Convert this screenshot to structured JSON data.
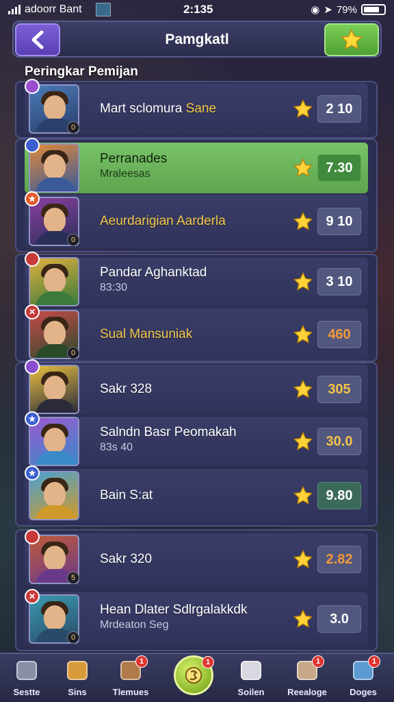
{
  "status_bar": {
    "carrier": "adoorr Bant",
    "time": "2:135",
    "battery": "79%"
  },
  "header": {
    "title": "Pamgkatl",
    "back_icon": "chevron-left-icon",
    "action_icon": "star-icon"
  },
  "section_title": "Peringkar Pemijan",
  "rows": [
    {
      "name": "Mart sclomura",
      "name2": "Sane",
      "sub": "",
      "score": "2 10",
      "avatar_colors": [
        "#4a7ab8",
        "#2a3f6b"
      ],
      "badge": "#9a4fcf",
      "badge_icon": "",
      "level": "0",
      "style": "normal"
    },
    {
      "name": "Perranades",
      "name2": "",
      "sub": "Mraleesas",
      "score": "7.30",
      "avatar_colors": [
        "#e08a3a",
        "#3a5a9a"
      ],
      "badge": "#3c5fd0",
      "badge_icon": "",
      "level": "",
      "style": "highlight"
    },
    {
      "name": "Aeurdarigian Aarderla",
      "name2": "",
      "sub": "",
      "score": "9 10",
      "avatar_colors": [
        "#8a3fa0",
        "#2a2f5a"
      ],
      "badge": "#e05a2a",
      "badge_icon": "★",
      "level": "0",
      "style": "gold"
    },
    {
      "name": "Pandar Aghanktad",
      "name2": "",
      "sub": "83:30",
      "score": "3 10",
      "avatar_colors": [
        "#e0b040",
        "#3a7a3a"
      ],
      "badge": "#c83a3a",
      "badge_icon": "",
      "level": "",
      "style": "normal"
    },
    {
      "name": "Sual Mansuniak",
      "name2": "",
      "sub": "",
      "score": "460",
      "avatar_colors": [
        "#c84a4a",
        "#2a4a2a"
      ],
      "badge": "#c83a3a",
      "badge_icon": "✕",
      "level": "0",
      "style": "gold"
    },
    {
      "name": "Sakr 328",
      "name2": "",
      "sub": "",
      "score": "305",
      "avatar_colors": [
        "#e8c040",
        "#2a2a3a"
      ],
      "badge": "#8a4fcf",
      "badge_icon": "",
      "level": "",
      "style": "normal"
    },
    {
      "name": "Salndn Basr Peomakah",
      "name2": "",
      "sub": "83s 40",
      "score": "30.0",
      "avatar_colors": [
        "#9a5ad0",
        "#3a8ac8"
      ],
      "badge": "#3c5fd0",
      "badge_icon": "★",
      "level": "",
      "style": "normal"
    },
    {
      "name": "Bain S:at",
      "name2": "",
      "sub": "",
      "score": "9.80",
      "avatar_colors": [
        "#4aa0d0",
        "#d09a2a"
      ],
      "badge": "#3c5fd0",
      "badge_icon": "★",
      "level": "",
      "style": "normal"
    },
    {
      "name": "Sakr 320",
      "name2": "",
      "sub": "",
      "score": "2.82",
      "avatar_colors": [
        "#c05a3a",
        "#6a3a8a"
      ],
      "badge": "#c83a3a",
      "badge_icon": "",
      "level": "5",
      "style": "normal"
    },
    {
      "name": "Hean Dlater Sdlrgalakkdk",
      "name2": "",
      "sub": "Mrdeaton Seg",
      "score": "3.0",
      "avatar_colors": [
        "#3a9ab0",
        "#2a4a6a"
      ],
      "badge": "#c83a3a",
      "badge_icon": "✕",
      "level": "0",
      "style": "normal"
    }
  ],
  "nav": [
    {
      "label": "Sestte",
      "icon": "puzzle-icon",
      "notif": ""
    },
    {
      "label": "Sins",
      "icon": "shield-icon",
      "notif": ""
    },
    {
      "label": "Tlemues",
      "icon": "chest-icon",
      "notif": "1"
    },
    {
      "label": "",
      "icon": "home-coin-icon",
      "notif": "1"
    },
    {
      "label": "Soilen",
      "icon": "heart-icon",
      "notif": ""
    },
    {
      "label": "Reealoge",
      "icon": "inbox-icon",
      "notif": "1"
    },
    {
      "label": "Doges",
      "icon": "card-icon",
      "notif": "1"
    }
  ]
}
